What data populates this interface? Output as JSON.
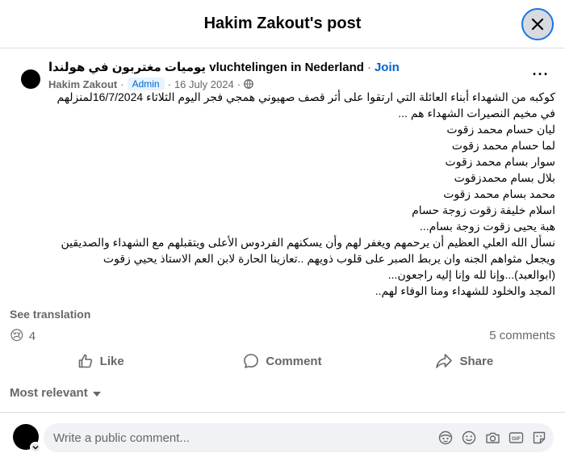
{
  "dialog": {
    "title": "Hakim Zakout's post"
  },
  "post": {
    "group_name": "يوميات مغتربون في هولندا vluchtelingen in Nederland",
    "dot": "·",
    "join_label": "Join",
    "author": "Hakim Zakout",
    "badge": "Admin",
    "date": "16 July 2024",
    "more_label": "···",
    "body_lines": [
      "كوكبه من الشهداء أبناء العائلة التي ارتقوا  على أثر قصف صهيوني همجي  فجر اليوم الثلاثاء 16/7/2024لمنزلهم",
      "في مخيم النصيرات الشهداء هم ...",
      "ليان حسام محمد زقوت",
      "لما حسام محمد زقوت",
      "سوار بسام محمد زقوت",
      "بلال بسام محمدزقوت",
      "محمد بسام محمد زقوت",
      "اسلام خليفة زقوت زوجة حسام",
      "هبة يحيى زقوت زوجة بسام...",
      " نسأل الله العلي العظيم أن يرحمهم ويغفر لهم وأن يسكنهم الفردوس الأعلى ويتقبلهم مع الشهداء والصديقين",
      "ويجعل مثواهم الجنه وان يربط الصبر على قلوب ذويهم  ..تعازينا الحارة لابن العم الاستاذ يحيي زقوت",
      "(ابوالعبد)...وإنا لله وإنا إليه راجعون...",
      "المجد والخلود للشهداء ومنا الوفاء لهم.."
    ],
    "see_translation": "See translation",
    "reaction_emoji": "😢",
    "reaction_count": "4",
    "comments_count": "5 comments"
  },
  "actions": {
    "like": "Like",
    "comment": "Comment",
    "share": "Share"
  },
  "comments": {
    "sort_label": "Most relevant"
  },
  "composer": {
    "placeholder": "Write a public comment..."
  },
  "colors": {
    "accent": "#0064d1",
    "muted": "#65676b",
    "badge_bg": "#e7f3ff",
    "input_bg": "#f0f2f5"
  }
}
